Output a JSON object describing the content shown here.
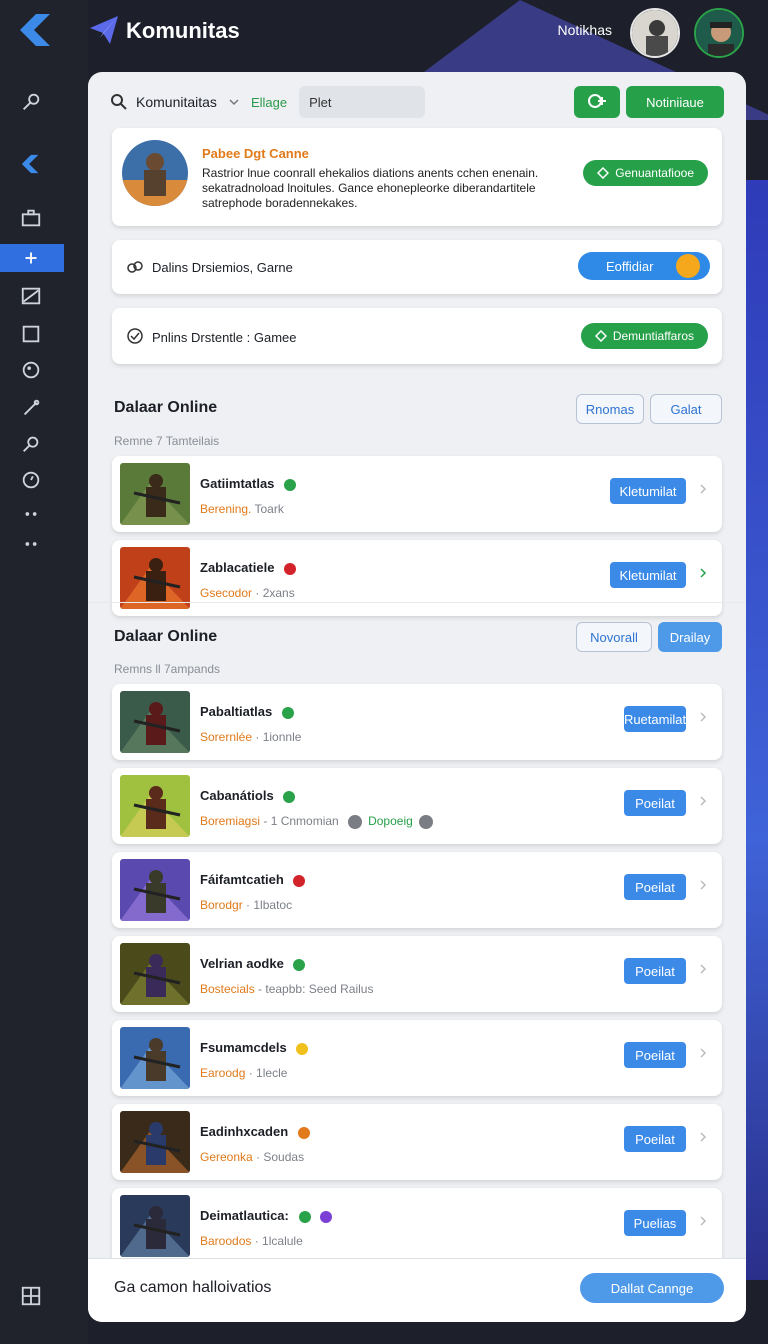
{
  "app": {
    "title": "Komunitas",
    "notif_label": "Notikhas"
  },
  "search": {
    "scope": "Komunitaitas",
    "filter": "Ellage",
    "value": "Plet"
  },
  "header_buttons": {
    "primary_label": "Notiniiaue"
  },
  "featured": {
    "title": "Pabee Dgt Canne",
    "description": "Rastrior lnue coonrall ehekalios diations anents cchen enenain. sekatradnoload lnoitules. Gance ehonepleorke diberandartitele satrephode boradennekakes.",
    "action_label": "Genuantafiooe"
  },
  "rows": [
    {
      "text": "Dalins Drsiemios, Garne",
      "toggle_label": "Eoffidiar"
    },
    {
      "text": "Pnlins Drstentle : Gamee",
      "action_label": "Demuntiaffaros"
    }
  ],
  "section1": {
    "title": "Dalaar Online",
    "subtitle": "Remne  7  Tamteilais",
    "btn_outline1": "Rnomas",
    "btn_outline2": "Galat",
    "items": [
      {
        "name": "Gatiimtatlas",
        "meta1": "Berening.",
        "meta2": "Toark",
        "action": "Kletumilat",
        "badge": "#2aa24a"
      },
      {
        "name": "Zablacatiele",
        "meta1": "Gsecodor",
        "meta2": "· 2xans",
        "action": "Kletumilat",
        "badge": "#d2232a"
      }
    ]
  },
  "section2": {
    "title": "Dalaar Online",
    "subtitle": "Remns  ll  7ampands",
    "btn_outline": "Novorall",
    "btn_blue": "Drailay",
    "items": [
      {
        "name": "Pabaltiatlas",
        "meta1": "Sorernlée",
        "meta2": "· 1ionnle",
        "action": "Ruetamilat",
        "badge": "#2aa24a"
      },
      {
        "name": "Cabanátiols",
        "meta1": "Boremiagsi",
        "meta2": "- 1  Cnmomian",
        "meta3": "Dopoeig",
        "action": "Poeilat",
        "badge": "#2aa24a"
      },
      {
        "name": "Fáifamtcatieh",
        "meta1": "Borodgr",
        "meta2": "· 1lbatoc",
        "action": "Poeilat",
        "badge": "#d2232a"
      },
      {
        "name": "Velrian aodke",
        "meta1": "Bostecials",
        "meta2": "- teapbb:  Seed Railus",
        "action": "Poeilat",
        "badge": "#2aa24a"
      },
      {
        "name": "Fsumamcdels",
        "meta1": "Earoodg",
        "meta2": "· 1lecle",
        "action": "Poeilat",
        "badge": "#f0c01c"
      },
      {
        "name": "Eadinhxcaden",
        "meta1": "Gereonka",
        "meta2": "· Soudas",
        "action": "Poeilat",
        "badge": "#e07a1a"
      },
      {
        "name": "Deimatlautica:",
        "meta1": "Baroodos",
        "meta2": "· 1lcalule",
        "action": "Puelias",
        "badge": "#2aa24a",
        "badge2": "#7b3fd6"
      }
    ]
  },
  "bottom": {
    "text": "Ga camon halloivatios",
    "button": "Dallat Cannge"
  },
  "colors": {
    "accent_blue": "#3b8ae8",
    "accent_green": "#27a04a",
    "sidebar_bg": "#20222c"
  }
}
